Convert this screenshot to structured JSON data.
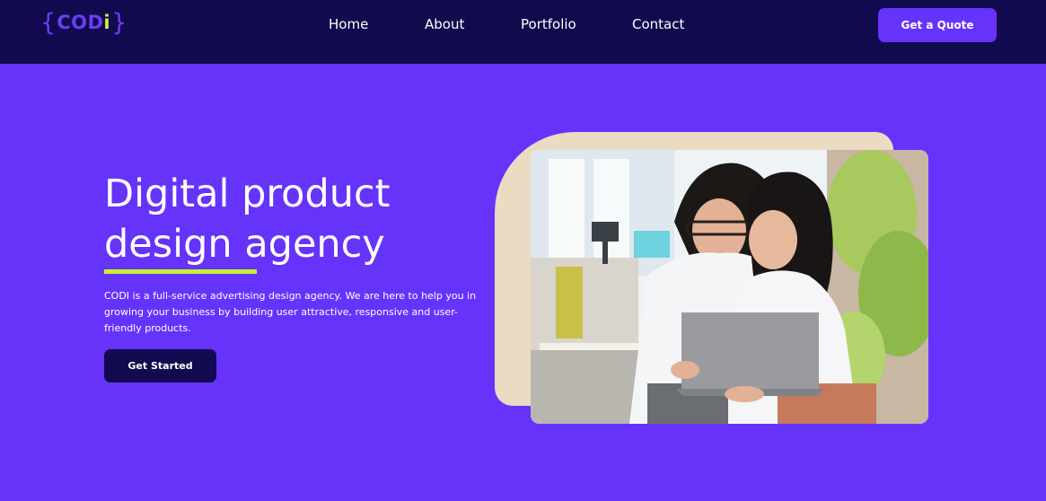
{
  "brand": {
    "open_brace": "{",
    "name_main": "COD",
    "name_accent": "i",
    "close_brace": "}",
    "primary_color": "#6633fb",
    "dark_color": "#110a4e",
    "accent_color": "#c6f135",
    "cream_color": "#ecdbc3"
  },
  "nav": {
    "items": [
      {
        "label": "Home"
      },
      {
        "label": "About"
      },
      {
        "label": "Portfolio"
      },
      {
        "label": "Contact"
      }
    ],
    "cta_label": "Get a Quote"
  },
  "hero": {
    "title_line1": "Digital product",
    "title_line2": "design agency",
    "description": "CODI is a full-service advertising design agency. We are here to help you in growing your business by building user attractive, responsive and user-friendly products.",
    "cta_label": "Get Started",
    "image_icon": "photo-two-women-laptop"
  }
}
